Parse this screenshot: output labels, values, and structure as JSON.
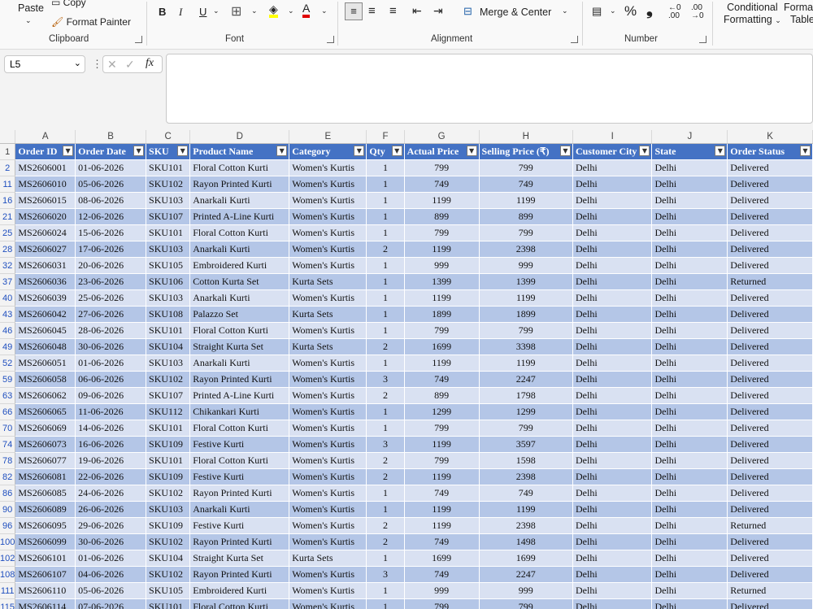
{
  "ribbon": {
    "paste": "Paste",
    "copy": "Copy",
    "format_painter": "Format Painter",
    "clipboard_label": "Clipboard",
    "font_label": "Font",
    "alignment_label": "Alignment",
    "merge_center": "Merge & Center",
    "number_label": "Number",
    "conditional_formatting_1": "Conditional",
    "conditional_formatting_2": "Formatting",
    "format_table_1": "Format",
    "format_table_2": "Table",
    "bold": "B",
    "italic": "I",
    "underline": "U",
    "percent": "%",
    "comma": "❟",
    "fx": "fx"
  },
  "namebox": {
    "value": "L5"
  },
  "columns": [
    "A",
    "B",
    "C",
    "D",
    "E",
    "F",
    "G",
    "H",
    "I",
    "J",
    "K"
  ],
  "headers": [
    "Order ID",
    "Order Date",
    "SKU",
    "Product Name",
    "Category",
    "Qty",
    "Actual Price",
    "Selling Price (₹)",
    "Customer City",
    "State",
    "Order Status"
  ],
  "rows": [
    {
      "n": "2",
      "id": "MS2606001",
      "date": "01-06-2026",
      "sku": "SKU101",
      "product": "Floral Cotton Kurti",
      "category": "Women's Kurtis",
      "qty": "1",
      "actual": "799",
      "selling": "799",
      "city": "Delhi",
      "state": "Delhi",
      "status": "Delivered"
    },
    {
      "n": "11",
      "id": "MS2606010",
      "date": "05-06-2026",
      "sku": "SKU102",
      "product": "Rayon Printed Kurti",
      "category": "Women's Kurtis",
      "qty": "1",
      "actual": "749",
      "selling": "749",
      "city": "Delhi",
      "state": "Delhi",
      "status": "Delivered"
    },
    {
      "n": "16",
      "id": "MS2606015",
      "date": "08-06-2026",
      "sku": "SKU103",
      "product": "Anarkali Kurti",
      "category": "Women's Kurtis",
      "qty": "1",
      "actual": "1199",
      "selling": "1199",
      "city": "Delhi",
      "state": "Delhi",
      "status": "Delivered"
    },
    {
      "n": "21",
      "id": "MS2606020",
      "date": "12-06-2026",
      "sku": "SKU107",
      "product": "Printed A-Line Kurti",
      "category": "Women's Kurtis",
      "qty": "1",
      "actual": "899",
      "selling": "899",
      "city": "Delhi",
      "state": "Delhi",
      "status": "Delivered"
    },
    {
      "n": "25",
      "id": "MS2606024",
      "date": "15-06-2026",
      "sku": "SKU101",
      "product": "Floral Cotton Kurti",
      "category": "Women's Kurtis",
      "qty": "1",
      "actual": "799",
      "selling": "799",
      "city": "Delhi",
      "state": "Delhi",
      "status": "Delivered"
    },
    {
      "n": "28",
      "id": "MS2606027",
      "date": "17-06-2026",
      "sku": "SKU103",
      "product": "Anarkali Kurti",
      "category": "Women's Kurtis",
      "qty": "2",
      "actual": "1199",
      "selling": "2398",
      "city": "Delhi",
      "state": "Delhi",
      "status": "Delivered"
    },
    {
      "n": "32",
      "id": "MS2606031",
      "date": "20-06-2026",
      "sku": "SKU105",
      "product": "Embroidered Kurti",
      "category": "Women's Kurtis",
      "qty": "1",
      "actual": "999",
      "selling": "999",
      "city": "Delhi",
      "state": "Delhi",
      "status": "Delivered"
    },
    {
      "n": "37",
      "id": "MS2606036",
      "date": "23-06-2026",
      "sku": "SKU106",
      "product": "Cotton Kurta Set",
      "category": "Kurta Sets",
      "qty": "1",
      "actual": "1399",
      "selling": "1399",
      "city": "Delhi",
      "state": "Delhi",
      "status": "Returned"
    },
    {
      "n": "40",
      "id": "MS2606039",
      "date": "25-06-2026",
      "sku": "SKU103",
      "product": "Anarkali Kurti",
      "category": "Women's Kurtis",
      "qty": "1",
      "actual": "1199",
      "selling": "1199",
      "city": "Delhi",
      "state": "Delhi",
      "status": "Delivered"
    },
    {
      "n": "43",
      "id": "MS2606042",
      "date": "27-06-2026",
      "sku": "SKU108",
      "product": "Palazzo Set",
      "category": "Kurta Sets",
      "qty": "1",
      "actual": "1899",
      "selling": "1899",
      "city": "Delhi",
      "state": "Delhi",
      "status": "Delivered"
    },
    {
      "n": "46",
      "id": "MS2606045",
      "date": "28-06-2026",
      "sku": "SKU101",
      "product": "Floral Cotton Kurti",
      "category": "Women's Kurtis",
      "qty": "1",
      "actual": "799",
      "selling": "799",
      "city": "Delhi",
      "state": "Delhi",
      "status": "Delivered"
    },
    {
      "n": "49",
      "id": "MS2606048",
      "date": "30-06-2026",
      "sku": "SKU104",
      "product": "Straight Kurta Set",
      "category": "Kurta Sets",
      "qty": "2",
      "actual": "1699",
      "selling": "3398",
      "city": "Delhi",
      "state": "Delhi",
      "status": "Delivered"
    },
    {
      "n": "52",
      "id": "MS2606051",
      "date": "01-06-2026",
      "sku": "SKU103",
      "product": "Anarkali Kurti",
      "category": "Women's Kurtis",
      "qty": "1",
      "actual": "1199",
      "selling": "1199",
      "city": "Delhi",
      "state": "Delhi",
      "status": "Delivered"
    },
    {
      "n": "59",
      "id": "MS2606058",
      "date": "06-06-2026",
      "sku": "SKU102",
      "product": "Rayon Printed Kurti",
      "category": "Women's Kurtis",
      "qty": "3",
      "actual": "749",
      "selling": "2247",
      "city": "Delhi",
      "state": "Delhi",
      "status": "Delivered"
    },
    {
      "n": "63",
      "id": "MS2606062",
      "date": "09-06-2026",
      "sku": "SKU107",
      "product": "Printed A-Line Kurti",
      "category": "Women's Kurtis",
      "qty": "2",
      "actual": "899",
      "selling": "1798",
      "city": "Delhi",
      "state": "Delhi",
      "status": "Delivered"
    },
    {
      "n": "66",
      "id": "MS2606065",
      "date": "11-06-2026",
      "sku": "SKU112",
      "product": "Chikankari Kurti",
      "category": "Women's Kurtis",
      "qty": "1",
      "actual": "1299",
      "selling": "1299",
      "city": "Delhi",
      "state": "Delhi",
      "status": "Delivered"
    },
    {
      "n": "70",
      "id": "MS2606069",
      "date": "14-06-2026",
      "sku": "SKU101",
      "product": "Floral Cotton Kurti",
      "category": "Women's Kurtis",
      "qty": "1",
      "actual": "799",
      "selling": "799",
      "city": "Delhi",
      "state": "Delhi",
      "status": "Delivered"
    },
    {
      "n": "74",
      "id": "MS2606073",
      "date": "16-06-2026",
      "sku": "SKU109",
      "product": "Festive Kurti",
      "category": "Women's Kurtis",
      "qty": "3",
      "actual": "1199",
      "selling": "3597",
      "city": "Delhi",
      "state": "Delhi",
      "status": "Delivered"
    },
    {
      "n": "78",
      "id": "MS2606077",
      "date": "19-06-2026",
      "sku": "SKU101",
      "product": "Floral Cotton Kurti",
      "category": "Women's Kurtis",
      "qty": "2",
      "actual": "799",
      "selling": "1598",
      "city": "Delhi",
      "state": "Delhi",
      "status": "Delivered"
    },
    {
      "n": "82",
      "id": "MS2606081",
      "date": "22-06-2026",
      "sku": "SKU109",
      "product": "Festive Kurti",
      "category": "Women's Kurtis",
      "qty": "2",
      "actual": "1199",
      "selling": "2398",
      "city": "Delhi",
      "state": "Delhi",
      "status": "Delivered"
    },
    {
      "n": "86",
      "id": "MS2606085",
      "date": "24-06-2026",
      "sku": "SKU102",
      "product": "Rayon Printed Kurti",
      "category": "Women's Kurtis",
      "qty": "1",
      "actual": "749",
      "selling": "749",
      "city": "Delhi",
      "state": "Delhi",
      "status": "Delivered"
    },
    {
      "n": "90",
      "id": "MS2606089",
      "date": "26-06-2026",
      "sku": "SKU103",
      "product": "Anarkali Kurti",
      "category": "Women's Kurtis",
      "qty": "1",
      "actual": "1199",
      "selling": "1199",
      "city": "Delhi",
      "state": "Delhi",
      "status": "Delivered"
    },
    {
      "n": "96",
      "id": "MS2606095",
      "date": "29-06-2026",
      "sku": "SKU109",
      "product": "Festive Kurti",
      "category": "Women's Kurtis",
      "qty": "2",
      "actual": "1199",
      "selling": "2398",
      "city": "Delhi",
      "state": "Delhi",
      "status": "Returned"
    },
    {
      "n": "100",
      "id": "MS2606099",
      "date": "30-06-2026",
      "sku": "SKU102",
      "product": "Rayon Printed Kurti",
      "category": "Women's Kurtis",
      "qty": "2",
      "actual": "749",
      "selling": "1498",
      "city": "Delhi",
      "state": "Delhi",
      "status": "Delivered"
    },
    {
      "n": "102",
      "id": "MS2606101",
      "date": "01-06-2026",
      "sku": "SKU104",
      "product": "Straight Kurta Set",
      "category": "Kurta Sets",
      "qty": "1",
      "actual": "1699",
      "selling": "1699",
      "city": "Delhi",
      "state": "Delhi",
      "status": "Delivered"
    },
    {
      "n": "108",
      "id": "MS2606107",
      "date": "04-06-2026",
      "sku": "SKU102",
      "product": "Rayon Printed Kurti",
      "category": "Women's Kurtis",
      "qty": "3",
      "actual": "749",
      "selling": "2247",
      "city": "Delhi",
      "state": "Delhi",
      "status": "Delivered"
    },
    {
      "n": "111",
      "id": "MS2606110",
      "date": "05-06-2026",
      "sku": "SKU105",
      "product": "Embroidered Kurti",
      "category": "Women's Kurtis",
      "qty": "1",
      "actual": "999",
      "selling": "999",
      "city": "Delhi",
      "state": "Delhi",
      "status": "Returned"
    },
    {
      "n": "115",
      "id": "MS2606114",
      "date": "07-06-2026",
      "sku": "SKU101",
      "product": "Floral Cotton Kurti",
      "category": "Women's Kurtis",
      "qty": "1",
      "actual": "799",
      "selling": "799",
      "city": "Delhi",
      "state": "Delhi",
      "status": "Delivered"
    }
  ],
  "colors": {
    "header_bg": "#4472c4",
    "band_dark": "#b4c6e7",
    "band_light": "#d9e1f2"
  }
}
